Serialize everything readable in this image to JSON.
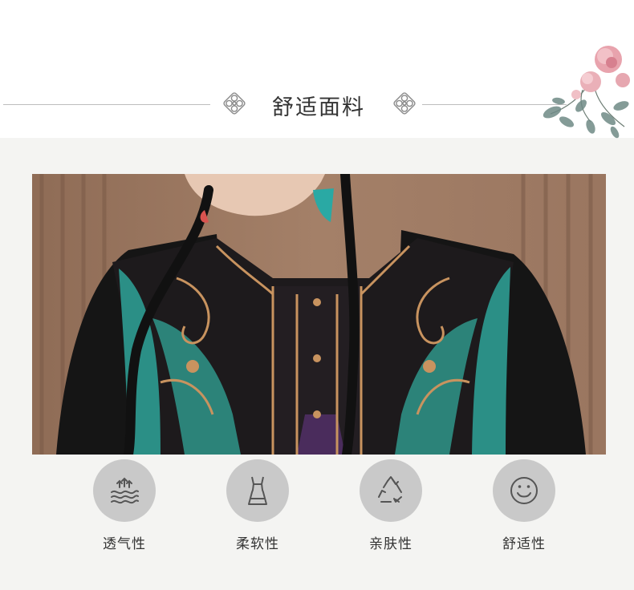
{
  "section": {
    "title": "舒适面料"
  },
  "features": [
    {
      "label": "透气性",
      "icon": "breathable-waves-icon"
    },
    {
      "label": "柔软性",
      "icon": "dress-icon"
    },
    {
      "label": "亲肤性",
      "icon": "recycle-icon"
    },
    {
      "label": "舒适性",
      "icon": "smiley-face-icon"
    }
  ],
  "colors": {
    "background": "#f4f4f2",
    "header": "#ffffff",
    "circle": "#c9c9c9",
    "icon": "#555555",
    "text": "#333333"
  }
}
